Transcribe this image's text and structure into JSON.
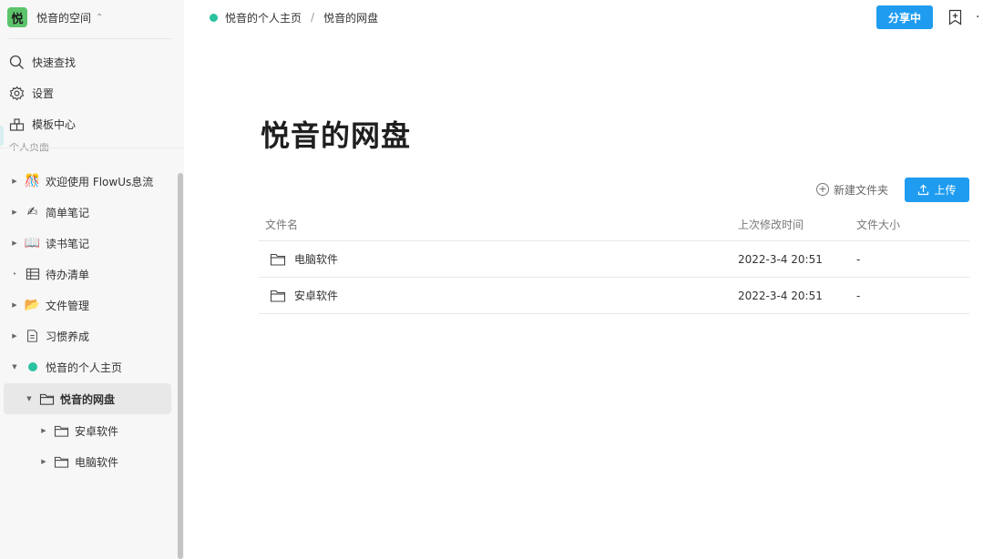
{
  "workspace": {
    "logo_char": "悦",
    "name": "悦音的空间",
    "chevron": "⌃",
    "logo_color": "#5cc36b"
  },
  "sidebar": {
    "quick_search": "快速查找",
    "settings": "设置",
    "templates": "模板中心",
    "section_label": "个人页面",
    "tree": [
      {
        "label": "欢迎使用 FlowUs息流",
        "icon": "🎊",
        "caret": "▶"
      },
      {
        "label": "简单笔记",
        "icon": "✍",
        "caret": "▶"
      },
      {
        "label": "读书笔记",
        "icon": "📖",
        "caret": "▶"
      },
      {
        "label": "待办清单",
        "icon": "table-icon",
        "caret": "•"
      },
      {
        "label": "文件管理",
        "icon": "📂",
        "caret": "▶"
      },
      {
        "label": "习惯养成",
        "icon": "document-icon",
        "caret": "▶"
      },
      {
        "label": "悦音的个人主页",
        "icon": "green-dot",
        "caret": "▼"
      },
      {
        "label": "悦音的网盘",
        "icon": "folder-icon",
        "caret": "▼",
        "active": true
      },
      {
        "label": "安卓软件",
        "icon": "folder-icon",
        "caret": "▶"
      },
      {
        "label": "电脑软件",
        "icon": "folder-icon",
        "caret": "▶"
      }
    ]
  },
  "breadcrumb": {
    "parent": "悦音的个人主页",
    "separator": "/",
    "current": "悦音的网盘"
  },
  "header": {
    "share_label": "分享中",
    "more": "·"
  },
  "page": {
    "title": "悦音的网盘"
  },
  "toolbar": {
    "new_folder": "新建文件夹",
    "plus": "+",
    "upload": "上传"
  },
  "table": {
    "columns": [
      "文件名",
      "上次修改时间",
      "文件大小"
    ],
    "rows": [
      {
        "name": "电脑软件",
        "modified": "2022-3-4 20:51",
        "size": "-"
      },
      {
        "name": "安卓软件",
        "modified": "2022-3-4 20:51",
        "size": "-"
      }
    ]
  },
  "colors": {
    "accent": "#1f9cf0",
    "page_dot": "#2bc2a0",
    "sidebar_bg": "#f7f7f7"
  }
}
